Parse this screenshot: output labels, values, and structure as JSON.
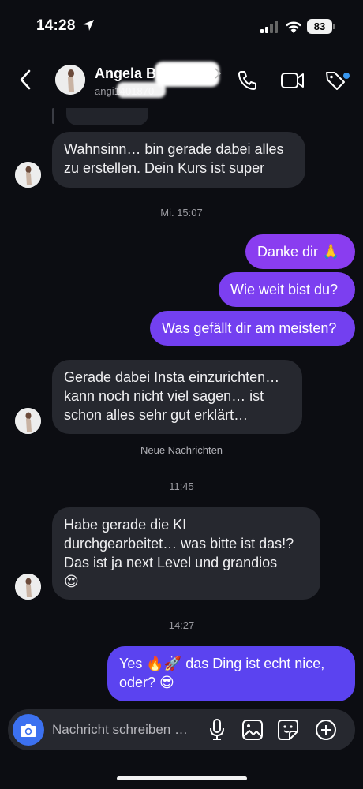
{
  "status_bar": {
    "time": "14:28",
    "battery": "83"
  },
  "header": {
    "name": "Angela B",
    "handle": "angi1401870"
  },
  "messages": [
    {
      "dir": "in",
      "text": "Wahnsinn… bin gerade dabei alles\nzu erstellen. Dein Kurs ist super"
    },
    {
      "stamp": "Mi. 15:07"
    },
    {
      "dir": "out",
      "text": "Danke dir 🙏"
    },
    {
      "dir": "out",
      "text": "Wie weit bist du?"
    },
    {
      "dir": "out",
      "text": "Was gefällt dir am meisten?"
    },
    {
      "dir": "in",
      "text": "Gerade dabei Insta einzurichten…\nkann noch nicht viel sagen… ist\nschon alles sehr gut erklärt…"
    },
    {
      "divider": "Neue Nachrichten"
    },
    {
      "stamp": "11:45"
    },
    {
      "dir": "in",
      "text": "Habe gerade die KI\ndurchgearbeitet… was bitte ist das!?\nDas ist ja next Level und grandios\n😍"
    },
    {
      "stamp": "14:27"
    },
    {
      "dir": "out",
      "text": "Yes 🔥🚀 das Ding ist echt nice,\noder? 😎"
    }
  ],
  "composer": {
    "placeholder": "Nachricht schreiben …"
  },
  "colors": {
    "out_bubble_top": "#8a3df0",
    "out_bubble_bottom": "#5b43f0",
    "in_bubble": "#26282f",
    "camera": "#3c71f0",
    "dot": "#3897f0"
  },
  "icons": [
    "location-arrow-icon",
    "signal-icon",
    "wifi-icon",
    "back-icon",
    "phone-icon",
    "video-icon",
    "tag-icon",
    "camera-icon",
    "mic-icon",
    "image-icon",
    "sticker-icon",
    "plus-icon"
  ]
}
